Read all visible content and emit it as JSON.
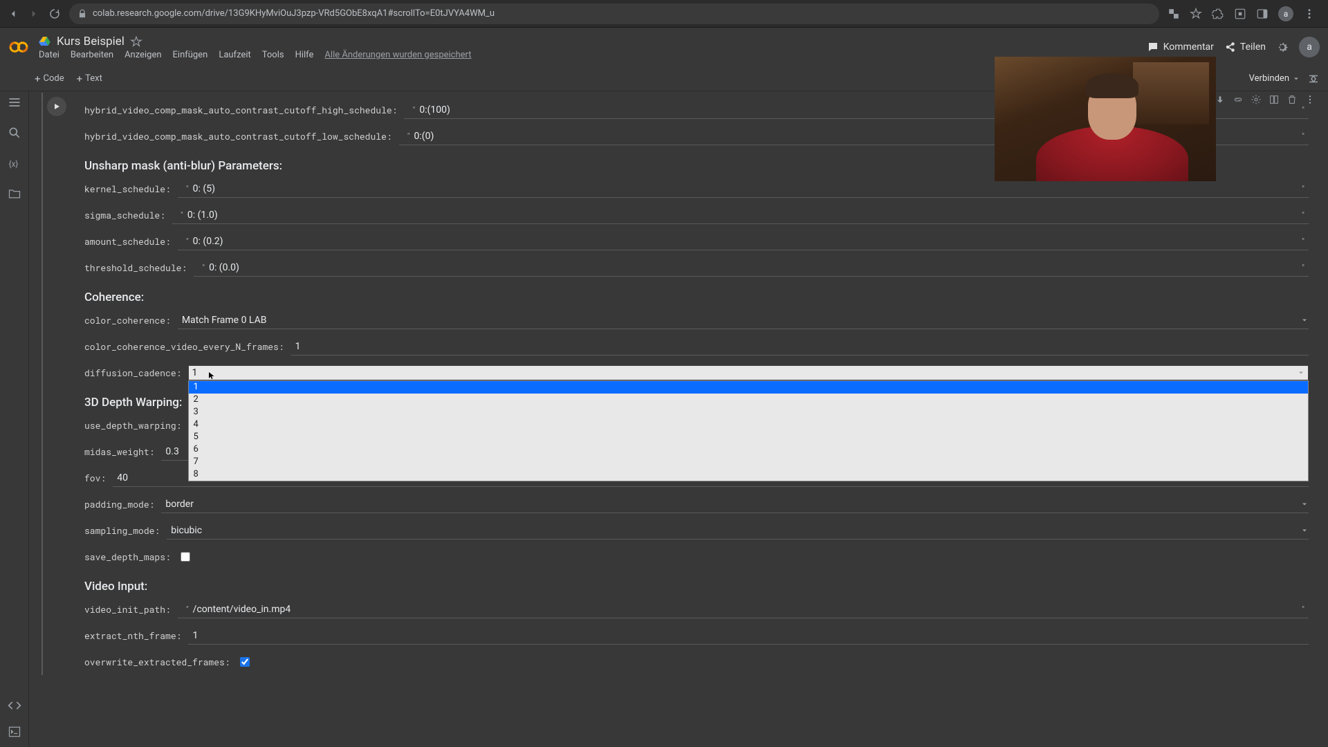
{
  "browser": {
    "url": "colab.research.google.com/drive/13G9KHyMviOuJ3pzp-VRd5GObE8xqA1#scrollTo=E0tJVYA4WM_u",
    "avatar": "a"
  },
  "header": {
    "title": "Kurs Beispiel",
    "menu": [
      "Datei",
      "Bearbeiten",
      "Anzeigen",
      "Einfügen",
      "Laufzeit",
      "Tools",
      "Hilfe"
    ],
    "save_msg": "Alle Änderungen wurden gespeichert",
    "comment": "Kommentar",
    "share": "Teilen",
    "account": "a"
  },
  "toolbar": {
    "code": "Code",
    "text": "Text",
    "connect": "Verbinden"
  },
  "form": {
    "rows": [
      {
        "label": "hybrid_video_comp_mask_auto_contrast_cutoff_high_schedule:",
        "value": "0:(100)",
        "quoted": true
      },
      {
        "label": "hybrid_video_comp_mask_auto_contrast_cutoff_low_schedule:",
        "value": "0:(0)",
        "quoted": true
      }
    ],
    "sec_unsharp": "Unsharp mask (anti-blur) Parameters:",
    "unsharp": [
      {
        "label": "kernel_schedule:",
        "value": "0: (5)",
        "quoted": true
      },
      {
        "label": "sigma_schedule:",
        "value": "0: (1.0)",
        "quoted": true
      },
      {
        "label": "amount_schedule:",
        "value": "0: (0.2)",
        "quoted": true
      },
      {
        "label": "threshold_schedule:",
        "value": "0: (0.0)",
        "quoted": true
      }
    ],
    "sec_coherence": "Coherence:",
    "coherence": {
      "color_coherence_label": "color_coherence:",
      "color_coherence_value": "Match Frame 0 LAB",
      "every_n_label": "color_coherence_video_every_N_frames:",
      "every_n_value": "1",
      "diffusion_label": "diffusion_cadence:",
      "diffusion_value": "1",
      "diffusion_options": [
        "1",
        "2",
        "3",
        "4",
        "5",
        "6",
        "7",
        "8"
      ]
    },
    "sec_3d": "3D Depth Warping:",
    "depth": {
      "use_label": "use_depth_warping:",
      "midas_label": "midas_weight:",
      "midas_value": "0.3",
      "fov_label": "fov:",
      "fov_value": "40",
      "padding_label": "padding_mode:",
      "padding_value": "border",
      "sampling_label": "sampling_mode:",
      "sampling_value": "bicubic",
      "save_label": "save_depth_maps:"
    },
    "sec_video": "Video Input:",
    "video": {
      "path_label": "video_init_path:",
      "path_value": "/content/video_in.mp4",
      "nth_label": "extract_nth_frame:",
      "nth_value": "1",
      "overwrite_label": "overwrite_extracted_frames:"
    }
  }
}
